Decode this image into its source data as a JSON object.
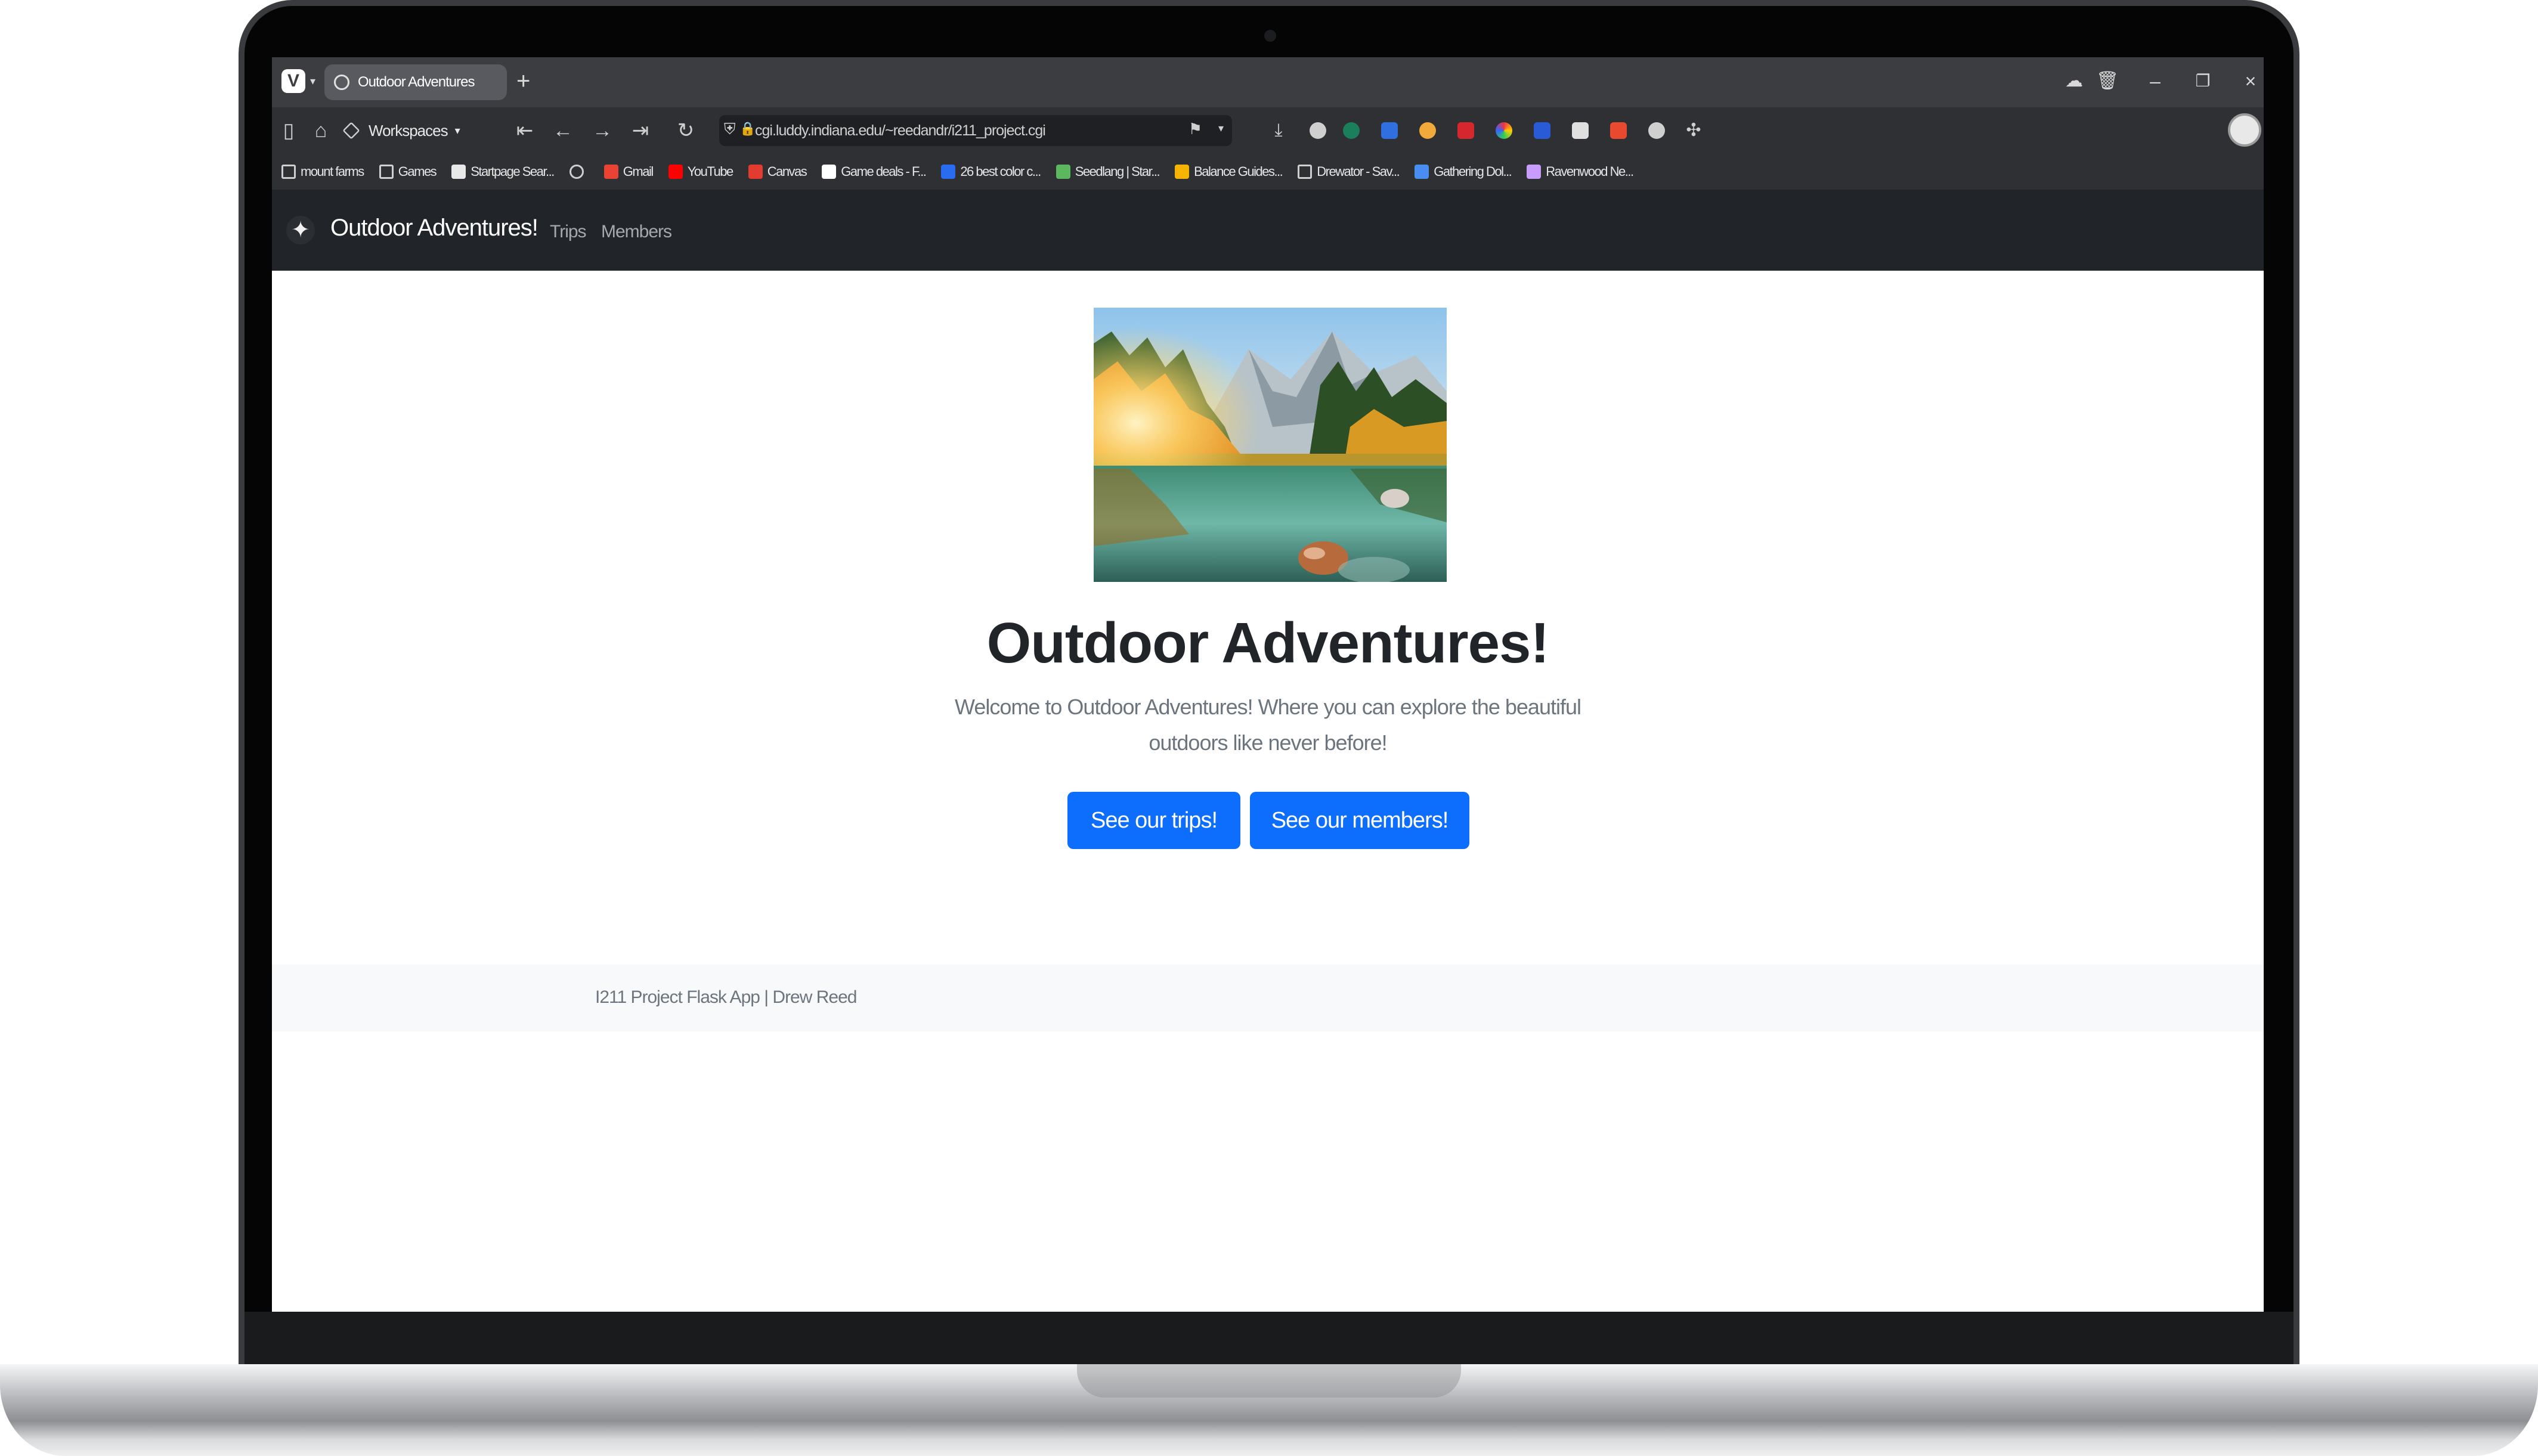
{
  "browser": {
    "tab_title": "Outdoor Adventures",
    "workspaces_label": "Workspaces",
    "url": "cgi.luddy.indiana.edu/~reedandr/i211_project.cgi",
    "bookmarks": [
      {
        "label": "mount farms",
        "icon": "folder-icon",
        "color": "#cfcfcf"
      },
      {
        "label": "Games",
        "icon": "folder-icon",
        "color": "#cfcfcf"
      },
      {
        "label": "Startpage Sear...",
        "icon": "search-icon",
        "color": "#e8e8e8"
      },
      {
        "label": "",
        "icon": "globe-icon",
        "color": "#cfcfcf"
      },
      {
        "label": "Gmail",
        "icon": "gmail-icon",
        "color": "#ea4335"
      },
      {
        "label": "YouTube",
        "icon": "youtube-icon",
        "color": "#ff0000"
      },
      {
        "label": "Canvas",
        "icon": "canvas-icon",
        "color": "#e13c2d"
      },
      {
        "label": "Game deals - F...",
        "icon": "gg-icon",
        "color": "#ffffff"
      },
      {
        "label": "26 best color c...",
        "icon": "w-icon",
        "color": "#2a6cf0"
      },
      {
        "label": "Seedlang | Star...",
        "icon": "check-icon",
        "color": "#5cb85c"
      },
      {
        "label": "Balance Guides...",
        "icon": "hex-icon",
        "color": "#f4b400"
      },
      {
        "label": "Drewator - Sav...",
        "icon": "puzzle-icon",
        "color": "#cfcfcf"
      },
      {
        "label": "Gathering Dol...",
        "icon": "dol-icon",
        "color": "#4a8df0"
      },
      {
        "label": "Ravenwood Ne...",
        "icon": "raven-icon",
        "color": "#c89cff"
      }
    ]
  },
  "site": {
    "brand": "Outdoor Adventures!",
    "nav": [
      "Trips",
      "Members"
    ],
    "hero_image_alt": "mountain lake",
    "heading": "Outdoor Adventures!",
    "welcome": "Welcome to Outdoor Adventures! Where you can explore the beautiful outdoors like never before!",
    "buttons": {
      "trips": "See our trips!",
      "members": "See our members!"
    },
    "footer": "I211 Project Flask App | Drew Reed"
  },
  "colors": {
    "navbar": "#212529",
    "primary_button": "#0d6efd",
    "footer_bg": "#f8f9fa",
    "browser_chrome": "#2f3034"
  }
}
